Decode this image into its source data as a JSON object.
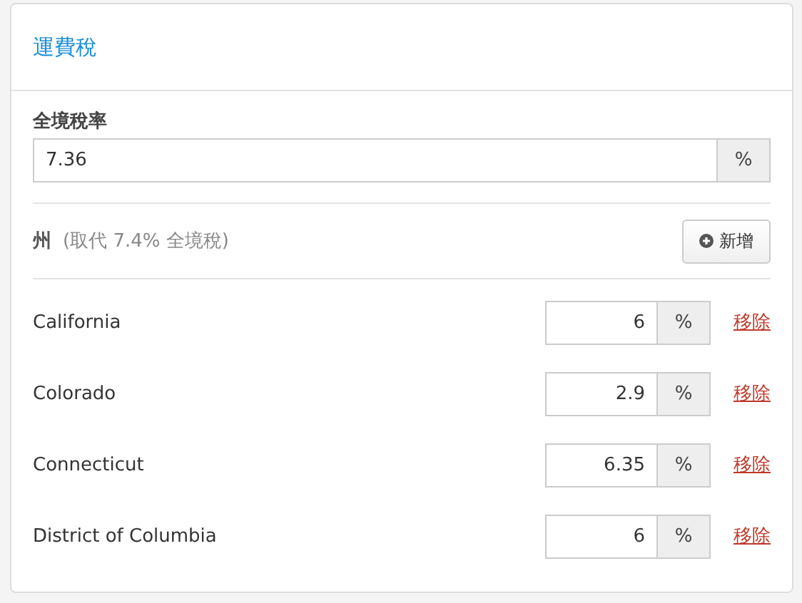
{
  "card": {
    "title": "運費稅"
  },
  "overall_rate": {
    "label": "全境稅率",
    "value": "7.36",
    "unit": "%"
  },
  "states_header": {
    "label": "州",
    "note": "(取代 7.4% 全境稅)",
    "add_button": "新增"
  },
  "states": [
    {
      "name": "California",
      "value": "6",
      "unit": "%",
      "remove": "移除"
    },
    {
      "name": "Colorado",
      "value": "2.9",
      "unit": "%",
      "remove": "移除"
    },
    {
      "name": "Connecticut",
      "value": "6.35",
      "unit": "%",
      "remove": "移除"
    },
    {
      "name": "District of Columbia",
      "value": "6",
      "unit": "%",
      "remove": "移除"
    }
  ]
}
